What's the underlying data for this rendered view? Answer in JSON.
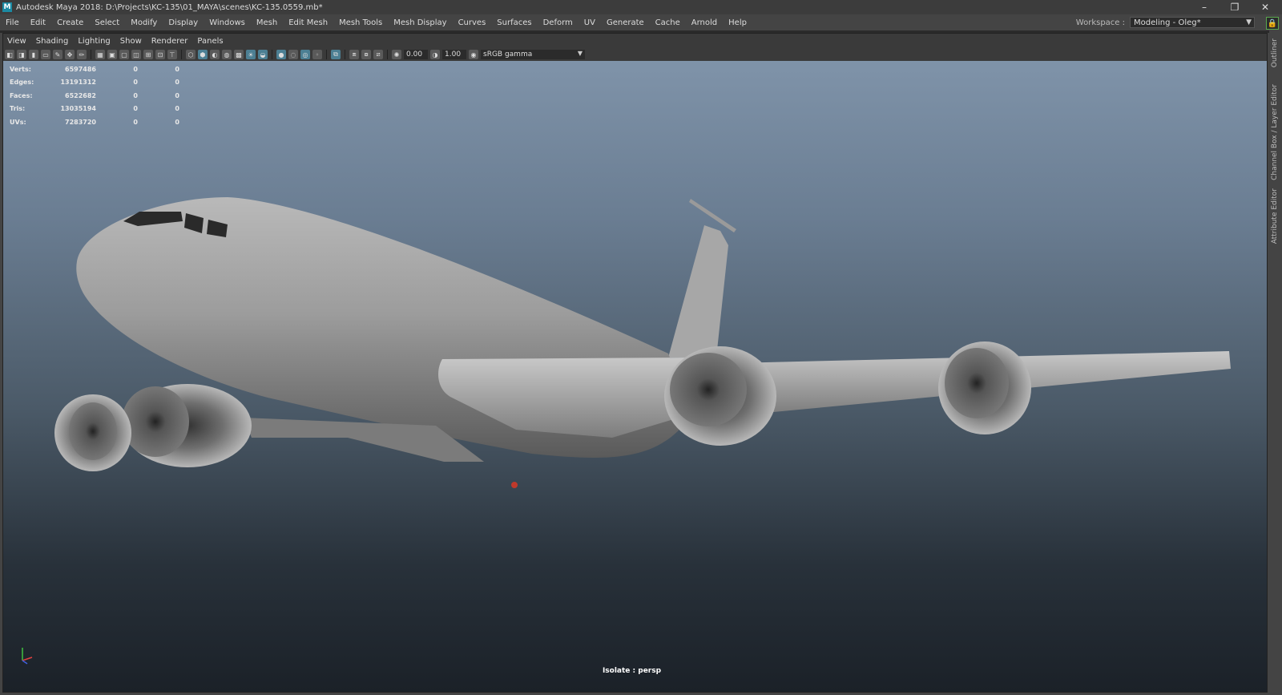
{
  "window": {
    "title": "Autodesk Maya 2018: D:\\Projects\\KC-135\\01_MAYA\\scenes\\KC-135.0559.mb*",
    "logo": "M",
    "controls": {
      "minimize": "–",
      "restore": "❐",
      "close": "✕"
    }
  },
  "menubar": {
    "items": [
      "File",
      "Edit",
      "Create",
      "Select",
      "Modify",
      "Display",
      "Windows",
      "Mesh",
      "Edit Mesh",
      "Mesh Tools",
      "Mesh Display",
      "Curves",
      "Surfaces",
      "Deform",
      "UV",
      "Generate",
      "Cache",
      "Arnold",
      "Help"
    ]
  },
  "workspace": {
    "label": "Workspace :",
    "value": "Modeling - Oleg*"
  },
  "panel_menu": {
    "items": [
      "View",
      "Shading",
      "Lighting",
      "Show",
      "Renderer",
      "Panels"
    ]
  },
  "panel_toolbar": {
    "exposure": "0.00",
    "gamma": "1.00",
    "color_space": "sRGB gamma"
  },
  "hud": {
    "rows": [
      {
        "label": "Verts:",
        "value": "6597486",
        "a": "0",
        "b": "0"
      },
      {
        "label": "Edges:",
        "value": "13191312",
        "a": "0",
        "b": "0"
      },
      {
        "label": "Faces:",
        "value": "6522682",
        "a": "0",
        "b": "0"
      },
      {
        "label": "Tris:",
        "value": "13035194",
        "a": "0",
        "b": "0"
      },
      {
        "label": "UVs:",
        "value": "7283720",
        "a": "0",
        "b": "0"
      }
    ]
  },
  "viewport": {
    "status": "Isolate : persp"
  },
  "side_tabs": {
    "outliner": "Outliner",
    "channel_box": "Channel Box / Layer Editor",
    "attribute_editor": "Attribute Editor"
  },
  "colors": {
    "accent": "#1b8aa3",
    "lock": "#7fcf6a",
    "axis_x": "#e04040",
    "axis_y": "#40c040",
    "axis_z": "#4060e0"
  }
}
